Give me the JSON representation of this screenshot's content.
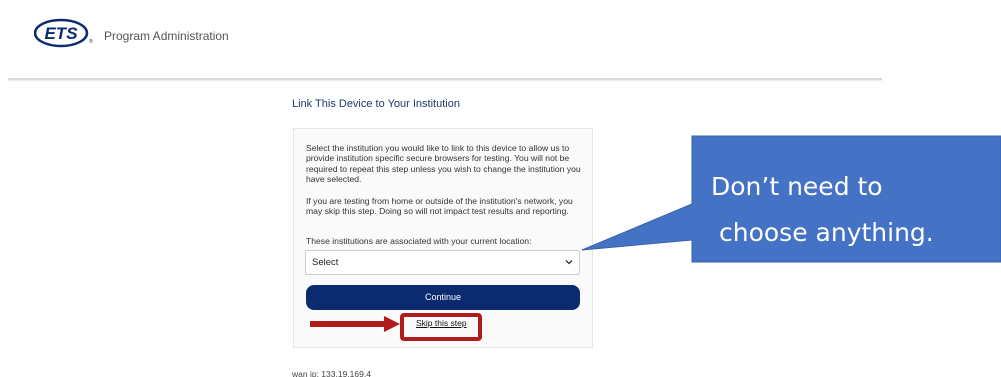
{
  "header": {
    "logo_text": "ETS",
    "subtitle": "Program Administration"
  },
  "main": {
    "title": "Link This Device to Your Institution",
    "paragraph1": "Select the institution you would like to link to this device to allow us to provide institution specific secure browsers for testing. You will not be required to repeat this step unless you wish to change the institution you have selected.",
    "paragraph2": "If you are testing from home or outside of the institution's network, you may skip this step. Doing so will not impact test results and reporting.",
    "paragraph3": "These institutions are associated with your current location:",
    "select_value": "Select",
    "continue_label": "Continue",
    "skip_label": "Skip this step",
    "wan_ip": "wan ip:  133.19.169.4"
  },
  "annotation": {
    "callout_line1": "Don’t need to",
    "callout_line2": "choose anything.",
    "callout_color": "#4472c4",
    "arrow_color": "#b01c1c"
  },
  "colors": {
    "brand_navy": "#0b2a6f",
    "title_blue": "#1a3a6e"
  }
}
